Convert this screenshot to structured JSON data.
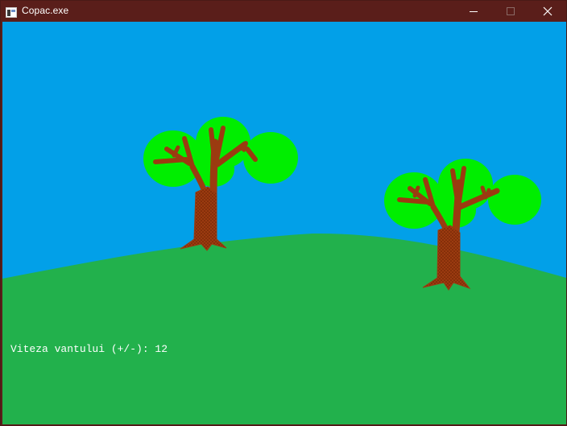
{
  "window": {
    "title": "Copac.exe",
    "controls": {
      "minimize_icon": "minimize-icon",
      "maximize_icon": "maximize-icon",
      "close_icon": "close-icon"
    }
  },
  "scene": {
    "colors": {
      "titlebar": "#5a1e1a",
      "sky": "#02a0e8",
      "grass": "#22b14c",
      "foliage": "#00ee00",
      "trunk": "#9b3b10",
      "trunk_dots": "#6a1f00"
    },
    "tree_count": 2
  },
  "status": {
    "wind_label": "Viteza vantului (+/-): 12"
  }
}
